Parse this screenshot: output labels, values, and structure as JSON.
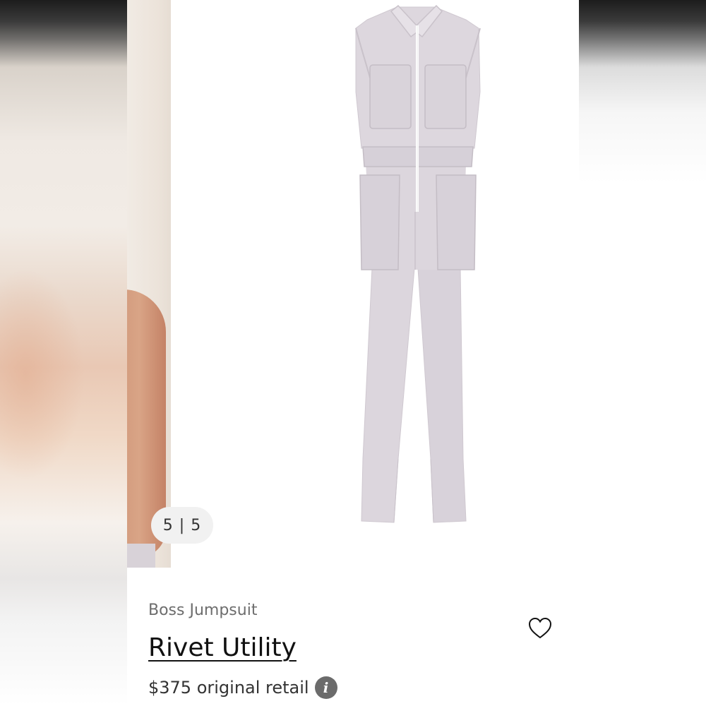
{
  "gallery": {
    "counter": "5 | 5"
  },
  "product": {
    "brand": "Boss Jumpsuit",
    "title": "Rivet Utility",
    "price": "$375 original retail"
  },
  "icons": {
    "favorite": "heart-icon",
    "info": "info-icon"
  },
  "colors": {
    "garment": "#dcd6dd",
    "text_primary": "#111111",
    "text_secondary": "#6d6d6d"
  }
}
